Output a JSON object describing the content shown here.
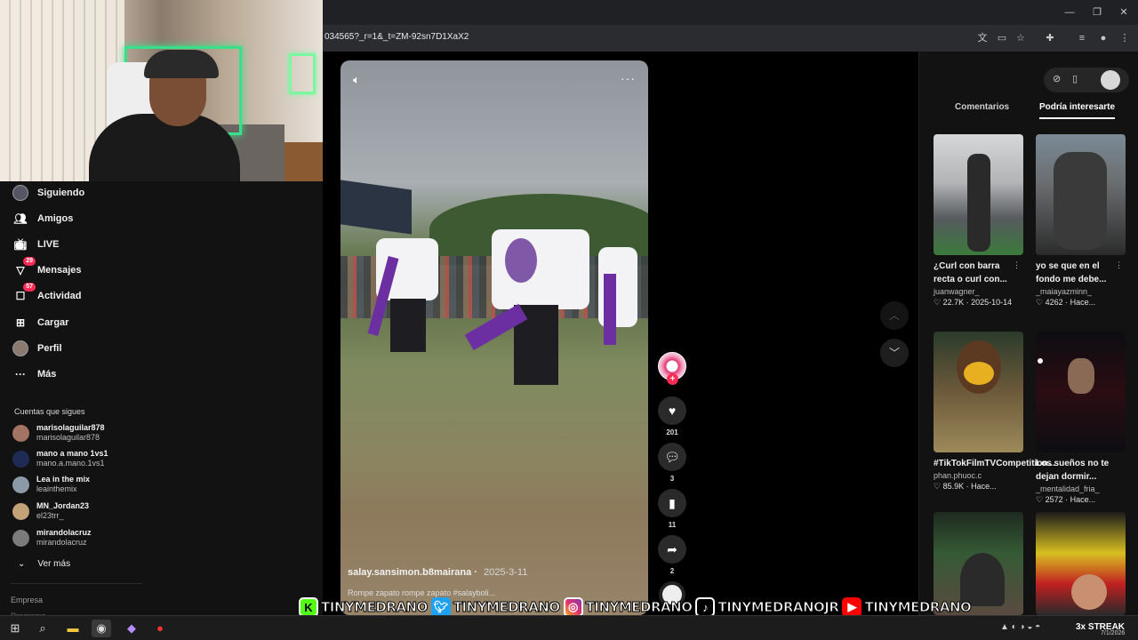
{
  "browser": {
    "url": "034565?_r=1&_t=ZM-92sn7D1XaX2",
    "window_controls": [
      "minimize-icon",
      "restore-icon",
      "close-icon"
    ],
    "toolbar_icons": [
      "translate-icon",
      "cast-icon",
      "star-icon",
      "extensions-icon",
      "media-icon",
      "profile-icon",
      "menu-icon"
    ]
  },
  "sidebar": {
    "items": [
      {
        "label": "Siguiendo",
        "icon": "following-icon"
      },
      {
        "label": "Amigos",
        "icon": "friends-icon"
      },
      {
        "label": "LIVE",
        "icon": "live-icon"
      },
      {
        "label": "Mensajes",
        "icon": "messages-icon",
        "badge": "29"
      },
      {
        "label": "Actividad",
        "icon": "activity-icon",
        "badge": "57"
      },
      {
        "label": "Cargar",
        "icon": "upload-icon"
      },
      {
        "label": "Perfil",
        "icon": "profile-icon"
      },
      {
        "label": "Más",
        "icon": "more-icon"
      }
    ],
    "following_title": "Cuentas que sigues",
    "following": [
      {
        "name": "marisolaguilar878",
        "handle": "marisolaguilar878"
      },
      {
        "name": "mano a mano 1vs1",
        "handle": "mano.a.mano.1vs1"
      },
      {
        "name": "Lea in the mix",
        "handle": "leainthemix"
      },
      {
        "name": "MN_Jordan23",
        "handle": "el23trr_"
      },
      {
        "name": "mirandolacruz",
        "handle": "mirandolacruz"
      }
    ],
    "see_more": "Ver más",
    "footer": [
      "Empresa",
      "Programa"
    ]
  },
  "video": {
    "author": "salay.sansimon.b8mairana",
    "date": "2025-3-11",
    "caption": "Rompe zapato rompe zapato    #salayboli...",
    "counts": {
      "likes": "201",
      "comments": "3",
      "saves": "11",
      "shares": "2"
    }
  },
  "right_panel": {
    "tabs": [
      "Comentarios",
      "Podría interesarte"
    ],
    "active_tab": "Podría interesarte",
    "cards": [
      {
        "title": "¿Curl con barra recta o curl con...",
        "author": "juanwagner_",
        "likes": "22.7K",
        "time": "2025-10-14"
      },
      {
        "title": "yo se que en el fondo me debe...",
        "author": "_maiayazminn_",
        "likes": "4262",
        "time": "Hace..."
      },
      {
        "title": "#TikTokFilmTVCompetition...",
        "author": "phan.phuoc.c",
        "likes": "85.9K",
        "time": "Hace..."
      },
      {
        "title": "Los sueños no te dejan dormir...",
        "author": "_mentalidad_fria_",
        "likes": "2572",
        "time": "Hace..."
      },
      {
        "title": "",
        "author": "",
        "likes": "",
        "time": ""
      },
      {
        "title": "",
        "author": "",
        "likes": "",
        "time": ""
      }
    ]
  },
  "overlay": [
    {
      "platform": "kick",
      "handle": "TINYMEDRANO",
      "color": "#53fc18"
    },
    {
      "platform": "twitter",
      "handle": "TINYMEDRANO",
      "color": "#1da1f2"
    },
    {
      "platform": "instagram",
      "handle": "TINYMEDRANO",
      "color": "#e1306c"
    },
    {
      "platform": "tiktok",
      "handle": "TINYMEDRANOJR",
      "color": "#000000"
    },
    {
      "platform": "youtube",
      "handle": "TINYMEDRANO",
      "color": "#ff0000"
    }
  ],
  "taskbar": {
    "tray_app": "3x STREAK",
    "clock": "7/1/2026"
  },
  "colors": {
    "accent": "#fe2c55",
    "background": "#121212"
  }
}
